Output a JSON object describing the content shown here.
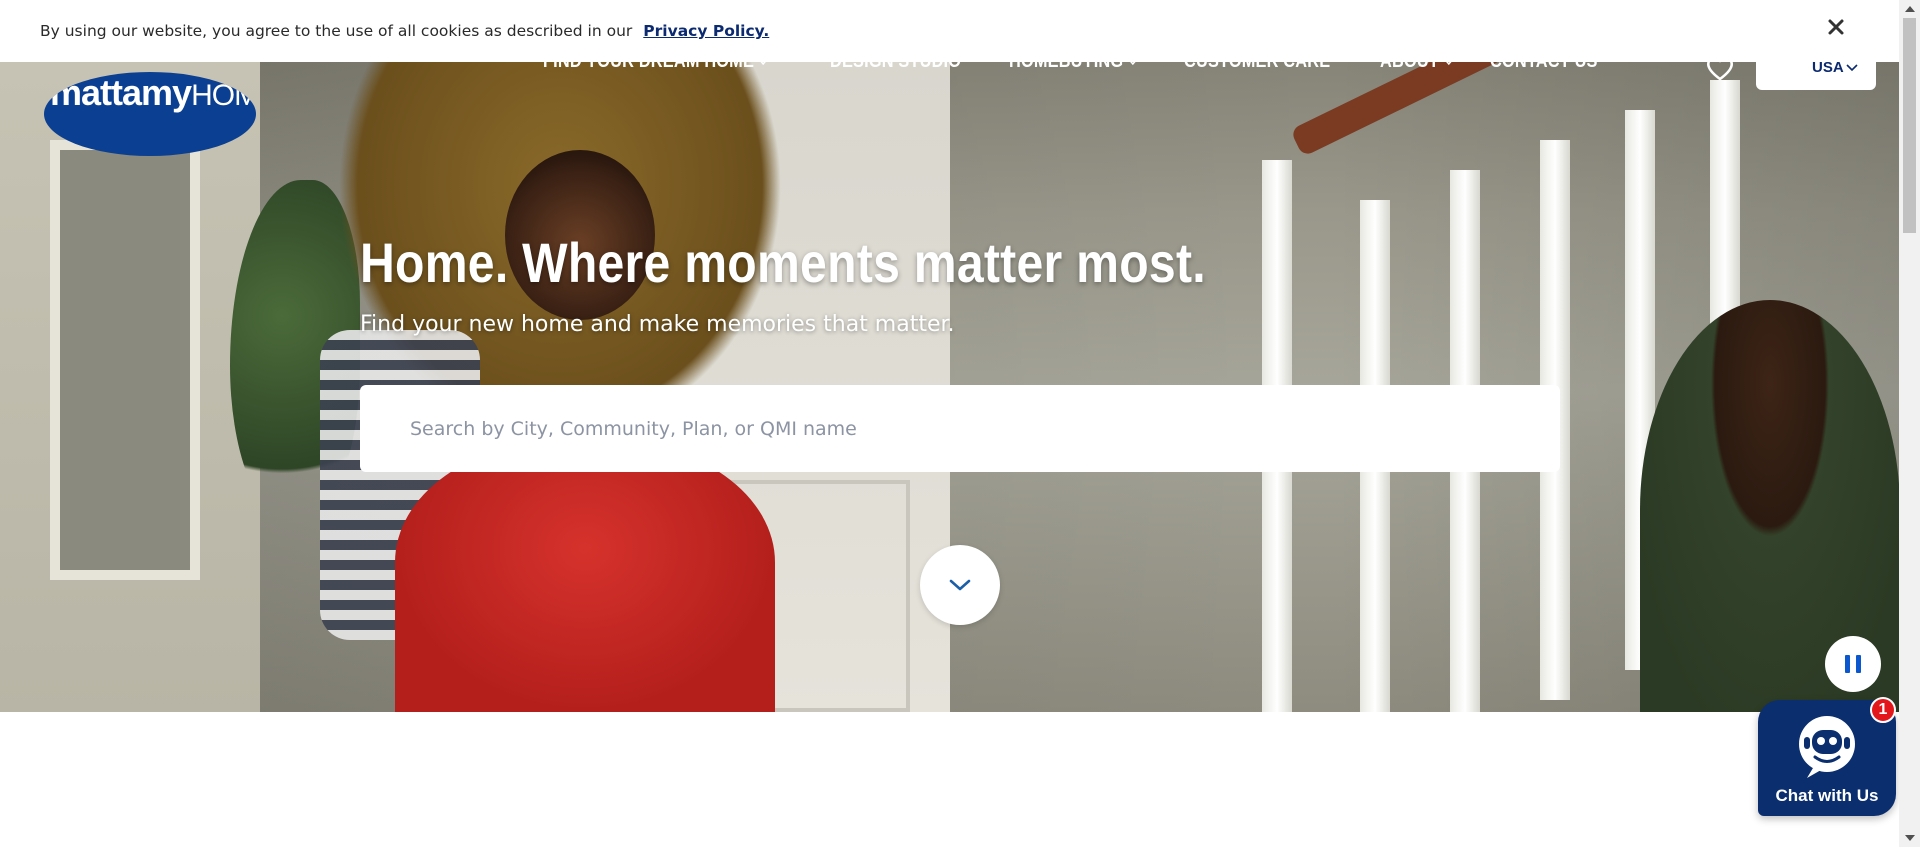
{
  "cookie_bar": {
    "message": "By using our website, you agree to the use of all cookies as described in our",
    "link_label": "Privacy Policy.",
    "close_icon": "close-icon"
  },
  "brand": {
    "logo_text_bold": "mattamy",
    "logo_text_light": "HOMES",
    "primary_color": "#0b3f91"
  },
  "nav": {
    "items": [
      {
        "label": "FIND YOUR DREAM HOME",
        "has_dropdown": true
      },
      {
        "label": "DESIGN STUDIO",
        "has_dropdown": false
      },
      {
        "label": "HOMEBUYING",
        "has_dropdown": true
      },
      {
        "label": "CUSTOMER CARE",
        "has_dropdown": false
      },
      {
        "label": "ABOUT",
        "has_dropdown": true
      },
      {
        "label": "CONTACT US",
        "has_dropdown": false
      }
    ],
    "favorites_icon": "heart-icon",
    "country_selector": "USA"
  },
  "hero": {
    "headline": "Home. Where moments matter most.",
    "subheadline": "Find your new home and make memories that matter.",
    "search_placeholder": "Search by City, Community, Plan, or QMI name"
  },
  "controls": {
    "scroll_down_icon": "chevron-down-icon",
    "pause_icon": "pause-icon"
  },
  "chat": {
    "label": "Chat with Us",
    "badge_count": "1",
    "bg_color": "#0b2e6f"
  }
}
